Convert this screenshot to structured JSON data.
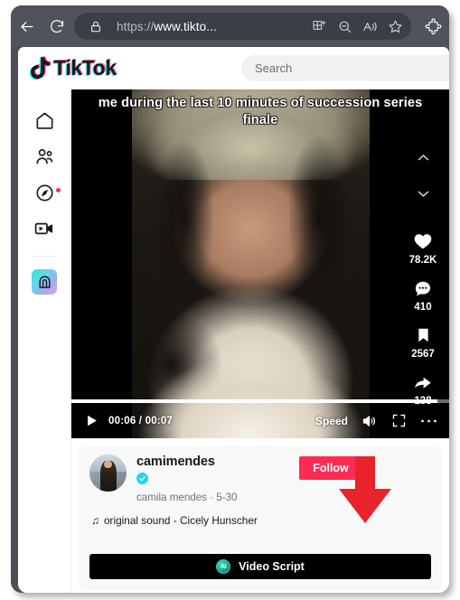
{
  "browser": {
    "back_label": "Back",
    "reload_label": "Refresh",
    "lock_icon": "lock-icon",
    "url_scheme": "https://",
    "url_rest": "www.tikto...",
    "url_full": "https://www.tikto...",
    "toolbar_icons": [
      {
        "name": "split-screen-icon",
        "glyph": "split-screen"
      },
      {
        "name": "zoom-out-icon",
        "glyph": "magnifier-minus"
      },
      {
        "name": "read-aloud-icon",
        "glyph": "a-sound-waves"
      },
      {
        "name": "favorite-star-icon",
        "glyph": "star"
      }
    ],
    "extensions_label": "Extensions"
  },
  "tiktok": {
    "logo_text": "TikTok",
    "search": {
      "placeholder": "Search",
      "value": ""
    },
    "sidebar": [
      {
        "name": "sidebar-item-for-you",
        "icon": "home-icon",
        "label": "For You",
        "badge": false
      },
      {
        "name": "sidebar-item-following",
        "icon": "people-icon",
        "label": "Following",
        "badge": false
      },
      {
        "name": "sidebar-item-explore",
        "icon": "compass-icon",
        "label": "Explore",
        "badge": true
      },
      {
        "name": "sidebar-item-live",
        "icon": "live-video-icon",
        "label": "LIVE",
        "badge": false
      },
      {
        "name": "sidebar-item-profile",
        "icon": "profile-avatar-icon",
        "label": "Profile",
        "badge": false
      }
    ]
  },
  "video": {
    "caption_overlay": "me during the last 10 minutes of succession series finale",
    "nav": {
      "prev_label": "Previous video",
      "next_label": "Next video"
    },
    "actions": [
      {
        "name": "like-button",
        "icon": "heart-icon",
        "count": "78.2K"
      },
      {
        "name": "comment-button",
        "icon": "comment-icon",
        "count": "410"
      },
      {
        "name": "bookmark-button",
        "icon": "bookmark-icon",
        "count": "2567"
      },
      {
        "name": "share-button",
        "icon": "share-arrow-icon",
        "count": "138"
      }
    ],
    "controls": {
      "play_label": "Play",
      "current_time": "00:06",
      "duration": "00:07",
      "time_display": "00:06 / 00:07",
      "speed_label": "Speed",
      "volume_label": "Volume",
      "fullscreen_label": "Fullscreen",
      "more_label": "More options"
    },
    "progress_percent": 97
  },
  "post": {
    "username": "camimendes",
    "verified": true,
    "nickname_and_date": "camila mendes · 5-30",
    "follow_label": "Follow",
    "music_icon": "♫",
    "music_text": "original sound - Cicely Hunscher"
  },
  "script_button": {
    "label": "Video Script",
    "badge_text": "AI",
    "badge_icon": "ai-hexagon-icon"
  },
  "annotation": {
    "arrow": "red-down-arrow",
    "color": "#e8232a"
  },
  "colors": {
    "tiktok_red": "#fe2c55",
    "verified_cyan": "#20d5ec",
    "toolbar_bg": "#50535a",
    "omnibox_bg": "#3b3e45",
    "annotation_red": "#e8232a"
  }
}
